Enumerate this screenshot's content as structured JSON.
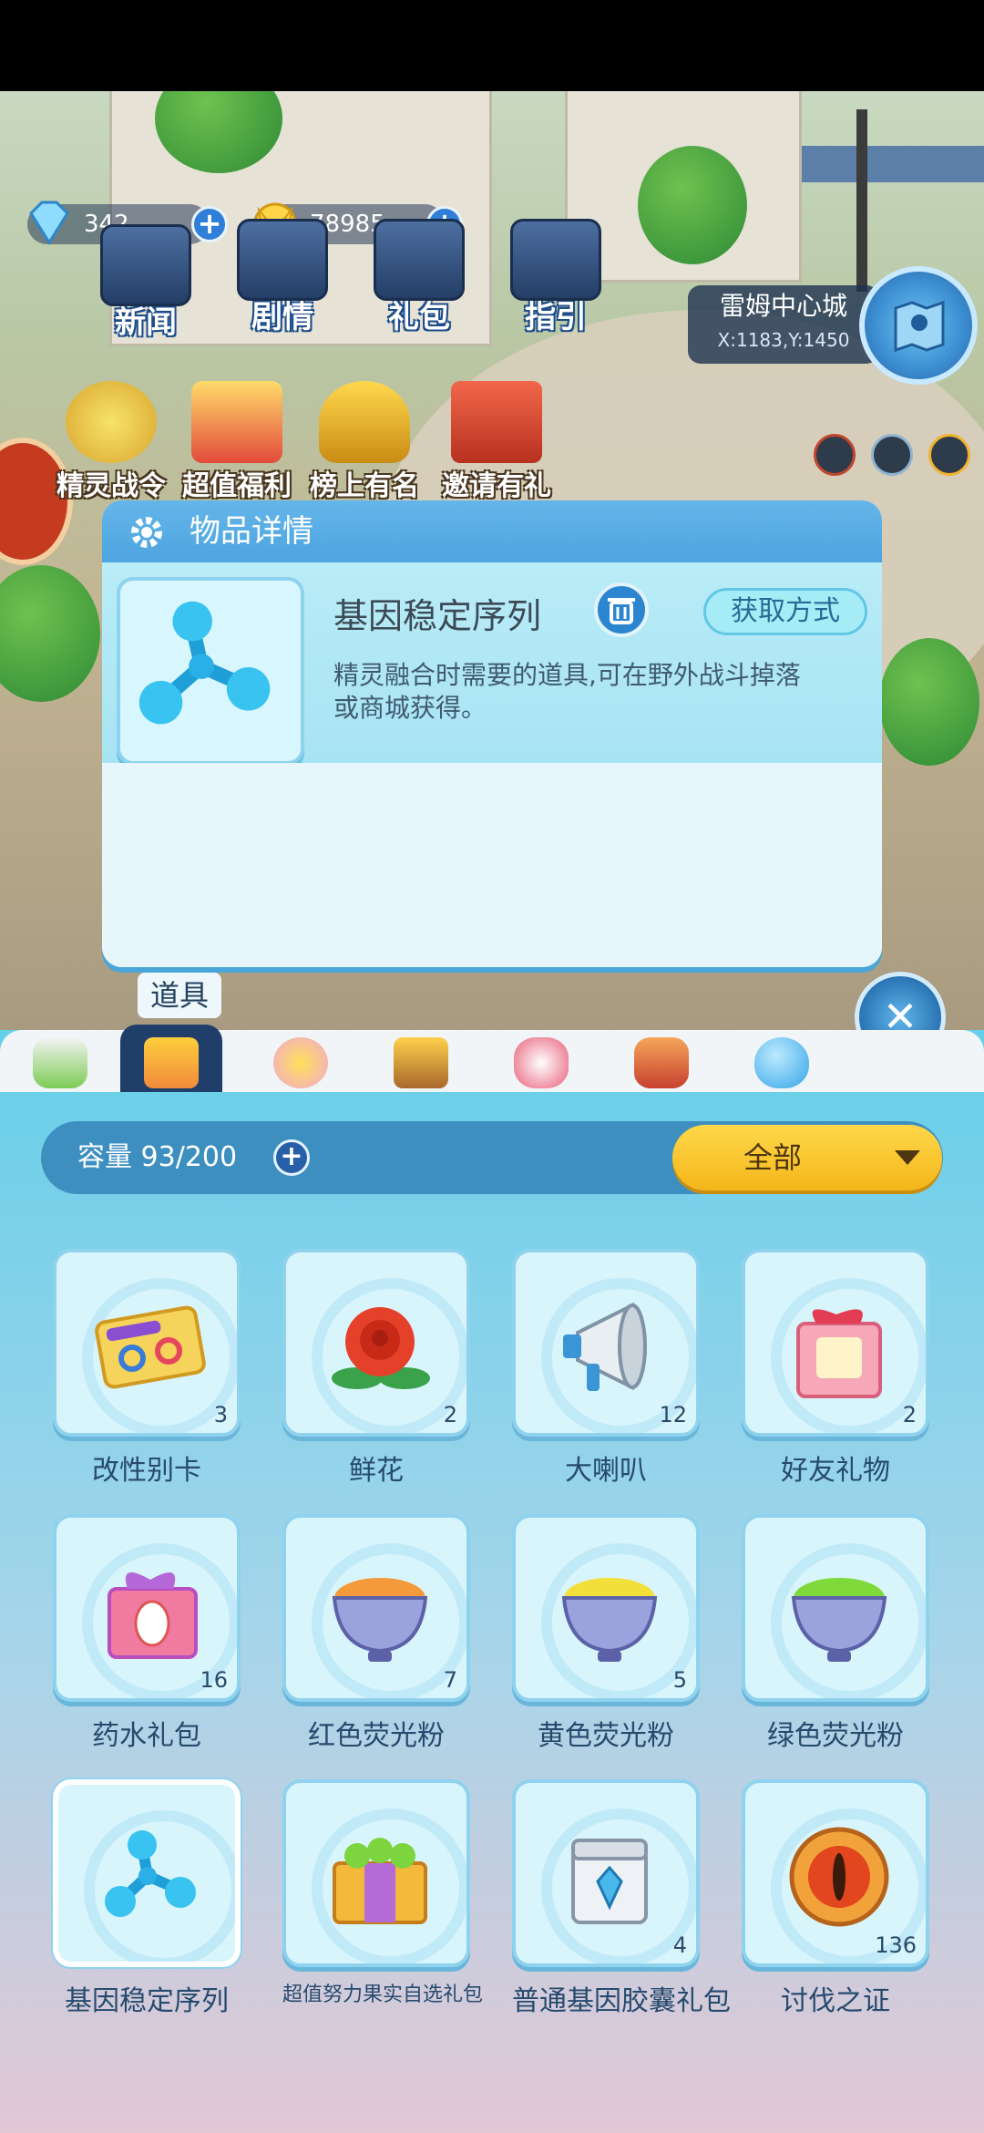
{
  "currencies": {
    "diamonds": "342",
    "coins": "78985"
  },
  "top_nav": [
    {
      "label": "新闻"
    },
    {
      "label": "剧情"
    },
    {
      "label": "礼包"
    },
    {
      "label": "指引"
    }
  ],
  "activities": [
    {
      "label": "精灵战令"
    },
    {
      "label": "超值福利"
    },
    {
      "label": "榜上有名"
    },
    {
      "label": "邀请有礼"
    }
  ],
  "location": {
    "city": "雷姆中心城",
    "coords": "X:1183,Y:1450"
  },
  "detail_panel": {
    "header": "物品详情",
    "item_name": "基因稳定序列",
    "obtain_button": "获取方式",
    "description": "精灵融合时需要的道具,可在野外战斗掉落或商城获得。"
  },
  "inventory": {
    "active_tab_tip": "道具",
    "capacity_label": "容量 93/200",
    "filter_selected": "全部",
    "items": [
      {
        "name": "改性别卡",
        "count": "3"
      },
      {
        "name": "鲜花",
        "count": "2"
      },
      {
        "name": "大喇叭",
        "count": "12"
      },
      {
        "name": "好友礼物",
        "count": "2"
      },
      {
        "name": "药水礼包",
        "count": "16"
      },
      {
        "name": "红色荧光粉",
        "count": "7"
      },
      {
        "name": "黄色荧光粉",
        "count": "5"
      },
      {
        "name": "绿色荧光粉",
        "count": ""
      },
      {
        "name": "基因稳定序列",
        "count": ""
      },
      {
        "name": "超值努力果实自选礼包",
        "count": ""
      },
      {
        "name": "普通基因胶囊礼包",
        "count": "4"
      },
      {
        "name": "讨伐之证",
        "count": "136"
      }
    ]
  },
  "icons": [
    "gear-icon",
    "trash-icon",
    "close-icon",
    "plus-icon",
    "map-icon",
    "chevron-down-icon"
  ],
  "colors": {
    "accent_blue": "#4ea4df",
    "filter_yellow": "#f4b619",
    "slot_border": "#8fd2ee"
  }
}
